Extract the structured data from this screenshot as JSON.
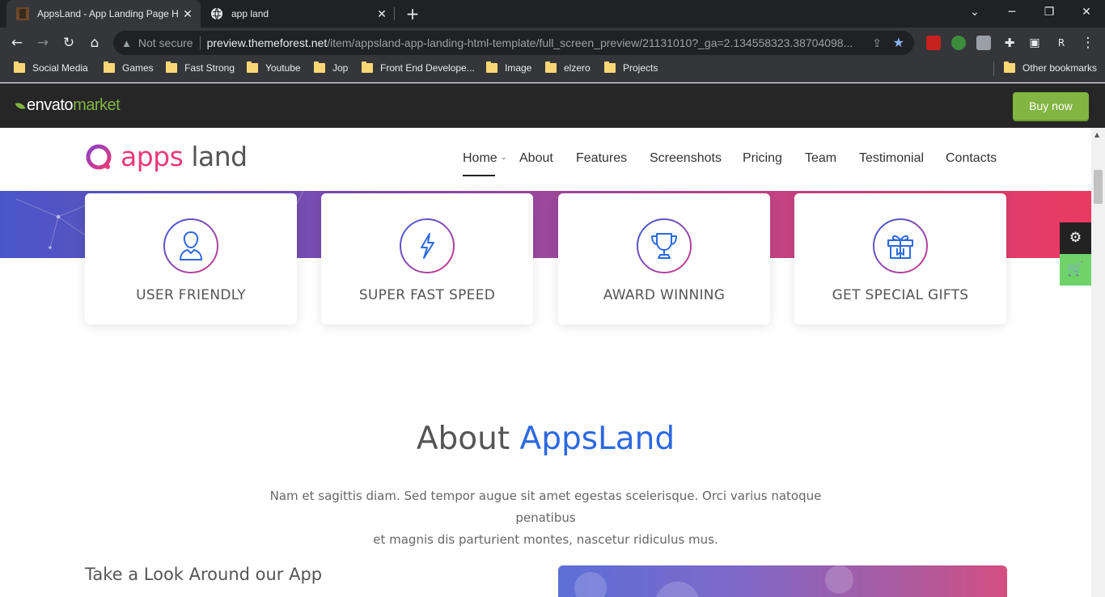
{
  "browser": {
    "tabs": [
      {
        "title": "AppsLand - App Landing Page H",
        "active": true
      },
      {
        "title": "app land",
        "active": false
      }
    ],
    "new_tab_label": "+",
    "window_controls": {
      "minimize": "─",
      "restore": "❐",
      "close": "✕",
      "dropdown": "⌄"
    },
    "address": {
      "security_label": "Not secure",
      "host": "preview.themeforest.net",
      "path": "/item/appsland-app-landing-html-template/full_screen_preview/21131010?_ga=2.134558323.38704098..."
    },
    "profile_initial": "R",
    "bookmarks": [
      "Social Media",
      "Games",
      "Fast Strong",
      "Youtube",
      "Jop",
      "Front End Develope...",
      "Image",
      "elzero",
      "Projects"
    ],
    "other_bookmarks": "Other bookmarks"
  },
  "envato": {
    "logo_part1": "envato",
    "logo_part2": "market",
    "buy_button": "Buy now",
    "colors": {
      "bar": "#262626",
      "accent": "#82b541"
    }
  },
  "site": {
    "logo_part1": "apps",
    "logo_part2": "land",
    "nav": [
      "Home",
      "About",
      "Features",
      "Screenshots",
      "Pricing",
      "Team",
      "Testimonial",
      "Contacts"
    ],
    "active_nav": "Home",
    "features": [
      {
        "label": "USER FRIENDLY",
        "icon": "user-icon"
      },
      {
        "label": "SUPER FAST SPEED",
        "icon": "lightning-icon"
      },
      {
        "label": "AWARD WINNING",
        "icon": "trophy-icon"
      },
      {
        "label": "GET SPECIAL GIFTS",
        "icon": "gift-icon"
      }
    ],
    "about": {
      "title_plain": "About",
      "title_accent": "AppsLand",
      "text_line1": "Nam et sagittis diam. Sed tempor augue sit amet egestas scelerisque. Orci varius natoque penatibus",
      "text_line2": "et magnis dis parturient montes, nascetur ridiculus mus."
    },
    "look_title": "Take a Look Around our App",
    "side_buttons": [
      {
        "icon": "gear-icon"
      },
      {
        "icon": "cart-icon"
      }
    ],
    "colors": {
      "accent_blue": "#2c69e0",
      "accent_pink": "#ea3a7a",
      "settings_btn": "#222222",
      "cart_btn": "#6fd36a"
    }
  }
}
